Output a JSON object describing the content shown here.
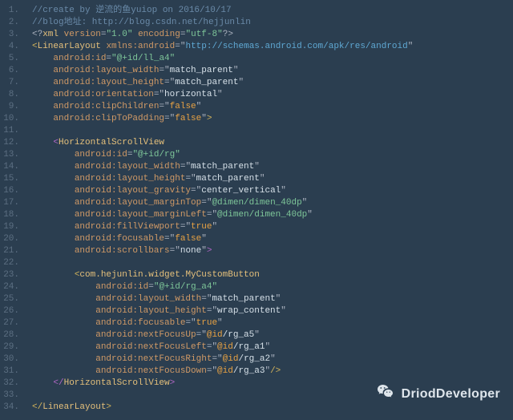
{
  "gutter": {
    "start": 1,
    "end": 34,
    "active": 34
  },
  "lines": {
    "l1": {
      "indent": "",
      "segs": [
        {
          "cls": "c-comment",
          "t": "//create by 逆流的鱼yuiop on 2016/10/17"
        }
      ]
    },
    "l2": {
      "indent": "",
      "segs": [
        {
          "cls": "c-comment",
          "t": "//blog地址: http://blog.csdn.net/hejjunlin"
        }
      ]
    },
    "l3": {
      "indent": "",
      "segs": [
        {
          "cls": "c-punct",
          "t": "<?"
        },
        {
          "cls": "c-tag",
          "t": "xml"
        },
        {
          "cls": "c-punct",
          "t": " "
        },
        {
          "cls": "c-attr",
          "t": "version"
        },
        {
          "cls": "c-punct",
          "t": "="
        },
        {
          "cls": "c-string",
          "t": "\"1.0\""
        },
        {
          "cls": "c-punct",
          "t": " "
        },
        {
          "cls": "c-attr",
          "t": "encoding"
        },
        {
          "cls": "c-punct",
          "t": "="
        },
        {
          "cls": "c-string",
          "t": "\"utf-8\""
        },
        {
          "cls": "c-punct",
          "t": "?>"
        }
      ]
    },
    "l4": {
      "indent": "",
      "segs": [
        {
          "cls": "bracket-y",
          "t": "<"
        },
        {
          "cls": "c-tag",
          "t": "LinearLayout"
        },
        {
          "cls": "c-punct",
          "t": " "
        },
        {
          "cls": "c-attr",
          "t": "xmlns:android"
        },
        {
          "cls": "c-punct",
          "t": "="
        },
        {
          "cls": "c-punct",
          "t": "\""
        },
        {
          "cls": "c-url",
          "t": "http://schemas.android.com/apk/res/android"
        },
        {
          "cls": "c-punct",
          "t": "\""
        }
      ]
    },
    "l5": {
      "indent": "    ",
      "segs": [
        {
          "cls": "c-attr",
          "t": "android:id"
        },
        {
          "cls": "c-punct",
          "t": "="
        },
        {
          "cls": "c-string",
          "t": "\"@+id/ll_a4\""
        }
      ]
    },
    "l6": {
      "indent": "    ",
      "segs": [
        {
          "cls": "c-attr",
          "t": "android:layout_width"
        },
        {
          "cls": "c-punct",
          "t": "=\""
        },
        {
          "cls": "c-val-white",
          "t": "match_parent"
        },
        {
          "cls": "c-punct",
          "t": "\""
        }
      ]
    },
    "l7": {
      "indent": "    ",
      "segs": [
        {
          "cls": "c-attr",
          "t": "android:layout_height"
        },
        {
          "cls": "c-punct",
          "t": "=\""
        },
        {
          "cls": "c-val-white",
          "t": "match_parent"
        },
        {
          "cls": "c-punct",
          "t": "\""
        }
      ]
    },
    "l8": {
      "indent": "    ",
      "segs": [
        {
          "cls": "c-attr",
          "t": "android:orientation"
        },
        {
          "cls": "c-punct",
          "t": "=\""
        },
        {
          "cls": "c-val-white",
          "t": "horizontal"
        },
        {
          "cls": "c-punct",
          "t": "\""
        }
      ]
    },
    "l9": {
      "indent": "    ",
      "segs": [
        {
          "cls": "c-attr",
          "t": "android:clipChildren"
        },
        {
          "cls": "c-punct",
          "t": "=\""
        },
        {
          "cls": "c-orange",
          "t": "false"
        },
        {
          "cls": "c-punct",
          "t": "\""
        }
      ]
    },
    "l10": {
      "indent": "    ",
      "segs": [
        {
          "cls": "c-attr",
          "t": "android:clipToPadding"
        },
        {
          "cls": "c-punct",
          "t": "=\""
        },
        {
          "cls": "c-orange",
          "t": "false"
        },
        {
          "cls": "c-punct",
          "t": "\""
        },
        {
          "cls": "bracket-y",
          "t": ">"
        }
      ]
    },
    "l11": {
      "indent": "",
      "segs": []
    },
    "l12": {
      "indent": "    ",
      "segs": [
        {
          "cls": "bracket-p",
          "t": "<"
        },
        {
          "cls": "c-tag",
          "t": "HorizontalScrollView"
        }
      ]
    },
    "l13": {
      "indent": "        ",
      "segs": [
        {
          "cls": "c-attr",
          "t": "android:id"
        },
        {
          "cls": "c-punct",
          "t": "="
        },
        {
          "cls": "c-string",
          "t": "\"@+id/rg\""
        }
      ]
    },
    "l14": {
      "indent": "        ",
      "segs": [
        {
          "cls": "c-attr",
          "t": "android:layout_width"
        },
        {
          "cls": "c-punct",
          "t": "=\""
        },
        {
          "cls": "c-val-white",
          "t": "match_parent"
        },
        {
          "cls": "c-punct",
          "t": "\""
        }
      ]
    },
    "l15": {
      "indent": "        ",
      "segs": [
        {
          "cls": "c-attr",
          "t": "android:layout_height"
        },
        {
          "cls": "c-punct",
          "t": "=\""
        },
        {
          "cls": "c-val-white",
          "t": "match_parent"
        },
        {
          "cls": "c-punct",
          "t": "\""
        }
      ]
    },
    "l16": {
      "indent": "        ",
      "segs": [
        {
          "cls": "c-attr",
          "t": "android:layout_gravity"
        },
        {
          "cls": "c-punct",
          "t": "=\""
        },
        {
          "cls": "c-val-white",
          "t": "center_vertical"
        },
        {
          "cls": "c-punct",
          "t": "\""
        }
      ]
    },
    "l17": {
      "indent": "        ",
      "segs": [
        {
          "cls": "c-attr",
          "t": "android:layout_marginTop"
        },
        {
          "cls": "c-punct",
          "t": "=\""
        },
        {
          "cls": "c-string",
          "t": "@dimen/dimen_40dp"
        },
        {
          "cls": "c-punct",
          "t": "\""
        }
      ]
    },
    "l18": {
      "indent": "        ",
      "segs": [
        {
          "cls": "c-attr",
          "t": "android:layout_marginLeft"
        },
        {
          "cls": "c-punct",
          "t": "=\""
        },
        {
          "cls": "c-string",
          "t": "@dimen/dimen_40dp"
        },
        {
          "cls": "c-punct",
          "t": "\""
        }
      ]
    },
    "l19": {
      "indent": "        ",
      "segs": [
        {
          "cls": "c-attr",
          "t": "android:fillViewport"
        },
        {
          "cls": "c-punct",
          "t": "=\""
        },
        {
          "cls": "c-orange",
          "t": "true"
        },
        {
          "cls": "c-punct",
          "t": "\""
        }
      ]
    },
    "l20": {
      "indent": "        ",
      "segs": [
        {
          "cls": "c-attr",
          "t": "android:focusable"
        },
        {
          "cls": "c-punct",
          "t": "=\""
        },
        {
          "cls": "c-orange",
          "t": "false"
        },
        {
          "cls": "c-punct",
          "t": "\""
        }
      ]
    },
    "l21": {
      "indent": "        ",
      "segs": [
        {
          "cls": "c-attr",
          "t": "android:scrollbars"
        },
        {
          "cls": "c-punct",
          "t": "=\""
        },
        {
          "cls": "c-val-white",
          "t": "none"
        },
        {
          "cls": "c-punct",
          "t": "\""
        },
        {
          "cls": "bracket-p",
          "t": ">"
        }
      ]
    },
    "l22": {
      "indent": "",
      "segs": []
    },
    "l23": {
      "indent": "        ",
      "segs": [
        {
          "cls": "bracket-y",
          "t": "<"
        },
        {
          "cls": "c-tag",
          "t": "com.hejunlin.widget.MyCustomButton"
        }
      ]
    },
    "l24": {
      "indent": "            ",
      "segs": [
        {
          "cls": "c-attr",
          "t": "android:id"
        },
        {
          "cls": "c-punct",
          "t": "="
        },
        {
          "cls": "c-string",
          "t": "\"@+id/rg_a4\""
        }
      ]
    },
    "l25": {
      "indent": "            ",
      "segs": [
        {
          "cls": "c-attr",
          "t": "android:layout_width"
        },
        {
          "cls": "c-punct",
          "t": "=\""
        },
        {
          "cls": "c-val-white",
          "t": "match_parent"
        },
        {
          "cls": "c-punct",
          "t": "\""
        }
      ]
    },
    "l26": {
      "indent": "            ",
      "segs": [
        {
          "cls": "c-attr",
          "t": "android:layout_height"
        },
        {
          "cls": "c-punct",
          "t": "=\""
        },
        {
          "cls": "c-val-white",
          "t": "wrap_content"
        },
        {
          "cls": "c-punct",
          "t": "\""
        }
      ]
    },
    "l27": {
      "indent": "            ",
      "segs": [
        {
          "cls": "c-attr",
          "t": "android:focusable"
        },
        {
          "cls": "c-punct",
          "t": "=\""
        },
        {
          "cls": "c-orange",
          "t": "true"
        },
        {
          "cls": "c-punct",
          "t": "\""
        }
      ]
    },
    "l28": {
      "indent": "            ",
      "segs": [
        {
          "cls": "c-attr",
          "t": "android:nextFocusUp"
        },
        {
          "cls": "c-punct",
          "t": "=\""
        },
        {
          "cls": "c-orange",
          "t": "@id"
        },
        {
          "cls": "c-val-white",
          "t": "/rg_a5"
        },
        {
          "cls": "c-punct",
          "t": "\""
        }
      ]
    },
    "l29": {
      "indent": "            ",
      "segs": [
        {
          "cls": "c-attr",
          "t": "android:nextFocusLeft"
        },
        {
          "cls": "c-punct",
          "t": "=\""
        },
        {
          "cls": "c-orange",
          "t": "@id"
        },
        {
          "cls": "c-val-white",
          "t": "/rg_a1"
        },
        {
          "cls": "c-punct",
          "t": "\""
        }
      ]
    },
    "l30": {
      "indent": "            ",
      "segs": [
        {
          "cls": "c-attr",
          "t": "android:nextFocusRight"
        },
        {
          "cls": "c-punct",
          "t": "=\""
        },
        {
          "cls": "c-orange",
          "t": "@id"
        },
        {
          "cls": "c-val-white",
          "t": "/rg_a2"
        },
        {
          "cls": "c-punct",
          "t": "\""
        }
      ]
    },
    "l31": {
      "indent": "            ",
      "segs": [
        {
          "cls": "c-attr",
          "t": "android:nextFocusDown"
        },
        {
          "cls": "c-punct",
          "t": "=\""
        },
        {
          "cls": "c-orange",
          "t": "@id"
        },
        {
          "cls": "c-val-white",
          "t": "/rg_a3"
        },
        {
          "cls": "c-punct",
          "t": "\""
        },
        {
          "cls": "bracket-y",
          "t": "/>"
        }
      ]
    },
    "l32": {
      "indent": "    ",
      "segs": [
        {
          "cls": "bracket-p",
          "t": "</"
        },
        {
          "cls": "c-tag",
          "t": "HorizontalScrollView"
        },
        {
          "cls": "bracket-p",
          "t": ">"
        }
      ]
    },
    "l33": {
      "indent": "",
      "segs": []
    },
    "l34": {
      "indent": "",
      "segs": [
        {
          "cls": "bracket-y",
          "t": "</"
        },
        {
          "cls": "c-tag",
          "t": "LinearLayout"
        },
        {
          "cls": "bracket-y",
          "t": ">"
        }
      ]
    }
  },
  "lineCount": 34,
  "watermark": {
    "text": "DriodDeveloper"
  }
}
